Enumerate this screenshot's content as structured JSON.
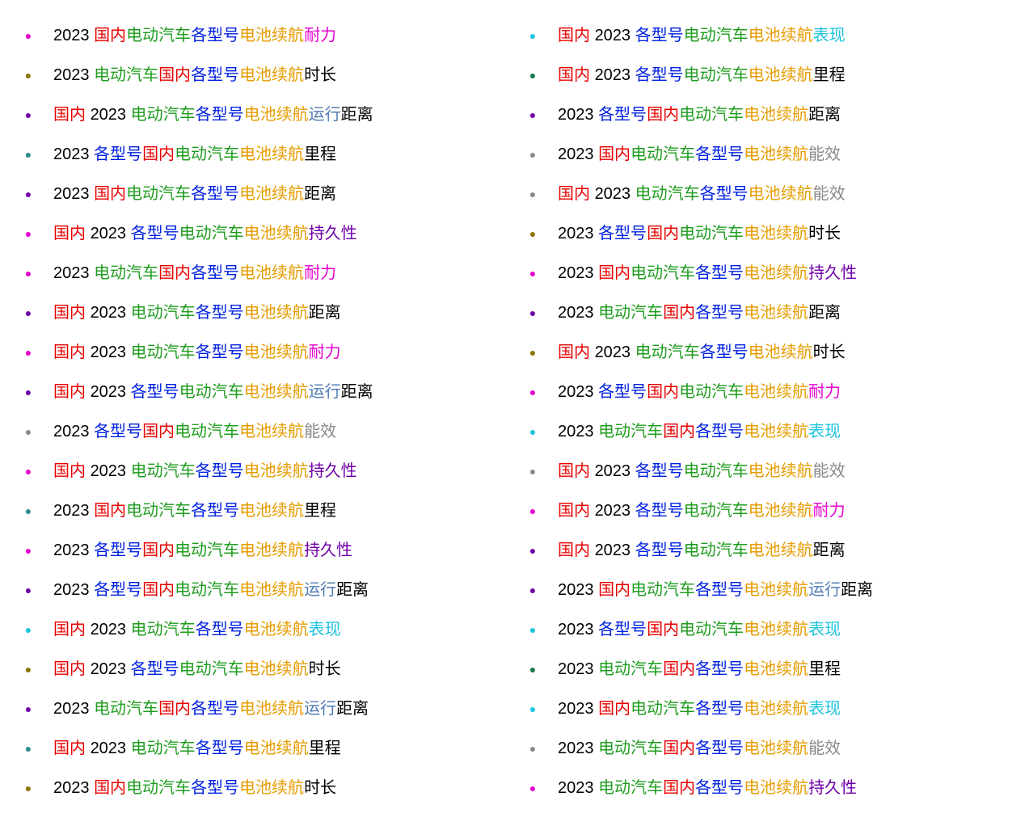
{
  "words": {
    "w2023": "2023 ",
    "guonei": "国内",
    "guonei_sp": "国内 ",
    "diandong": "电动汽车",
    "gexinghao": "各型号",
    "dianchi": "电池续航",
    "naili": "耐力",
    "shichang": "时长",
    "yunxing": "运行",
    "juli": "距离",
    "licheng": "里程",
    "chijiuxing": "持久性",
    "nengxiao": "能效",
    "biaoxian": "表现"
  },
  "bullet_colors": {
    "pink": "#e600cc",
    "darkkhaki": "#8b7300",
    "purple": "#6f00a8",
    "teal": "#2d8b8b",
    "gray": "#8a8a8a",
    "cyan": "#1cc3dd",
    "darkgreen": "#157a4a"
  },
  "left": [
    {
      "b": "pink",
      "seg": [
        [
          "black",
          "w2023"
        ],
        [
          "red",
          "guonei"
        ],
        [
          "green",
          "diandong"
        ],
        [
          "blue",
          "gexinghao"
        ],
        [
          "orange",
          "dianchi"
        ],
        [
          "pink",
          "naili"
        ]
      ]
    },
    {
      "b": "darkkhaki",
      "seg": [
        [
          "black",
          "w2023"
        ],
        [
          "green",
          "diandong"
        ],
        [
          "red",
          "guonei"
        ],
        [
          "blue",
          "gexinghao"
        ],
        [
          "orange",
          "dianchi"
        ],
        [
          "black",
          "shichang"
        ]
      ]
    },
    {
      "b": "purple",
      "seg": [
        [
          "red",
          "guonei_sp"
        ],
        [
          "black",
          "w2023"
        ],
        [
          "green",
          "diandong"
        ],
        [
          "blue",
          "gexinghao"
        ],
        [
          "orange",
          "dianchi"
        ],
        [
          "steel",
          "yunxing"
        ],
        [
          "black",
          "juli"
        ]
      ]
    },
    {
      "b": "teal",
      "seg": [
        [
          "black",
          "w2023"
        ],
        [
          "blue",
          "gexinghao"
        ],
        [
          "red",
          "guonei"
        ],
        [
          "green",
          "diandong"
        ],
        [
          "orange",
          "dianchi"
        ],
        [
          "black",
          "licheng"
        ]
      ]
    },
    {
      "b": "purple",
      "seg": [
        [
          "black",
          "w2023"
        ],
        [
          "red",
          "guonei"
        ],
        [
          "green",
          "diandong"
        ],
        [
          "blue",
          "gexinghao"
        ],
        [
          "orange",
          "dianchi"
        ],
        [
          "black",
          "juli"
        ]
      ]
    },
    {
      "b": "pink",
      "seg": [
        [
          "red",
          "guonei_sp"
        ],
        [
          "black",
          "w2023"
        ],
        [
          "blue",
          "gexinghao"
        ],
        [
          "green",
          "diandong"
        ],
        [
          "orange",
          "dianchi"
        ],
        [
          "purple",
          "chijiuxing"
        ]
      ]
    },
    {
      "b": "pink",
      "seg": [
        [
          "black",
          "w2023"
        ],
        [
          "green",
          "diandong"
        ],
        [
          "red",
          "guonei"
        ],
        [
          "blue",
          "gexinghao"
        ],
        [
          "orange",
          "dianchi"
        ],
        [
          "pink",
          "naili"
        ]
      ]
    },
    {
      "b": "purple",
      "seg": [
        [
          "red",
          "guonei_sp"
        ],
        [
          "black",
          "w2023"
        ],
        [
          "green",
          "diandong"
        ],
        [
          "blue",
          "gexinghao"
        ],
        [
          "orange",
          "dianchi"
        ],
        [
          "black",
          "juli"
        ]
      ]
    },
    {
      "b": "pink",
      "seg": [
        [
          "red",
          "guonei_sp"
        ],
        [
          "black",
          "w2023"
        ],
        [
          "green",
          "diandong"
        ],
        [
          "blue",
          "gexinghao"
        ],
        [
          "orange",
          "dianchi"
        ],
        [
          "pink",
          "naili"
        ]
      ]
    },
    {
      "b": "purple",
      "seg": [
        [
          "red",
          "guonei_sp"
        ],
        [
          "black",
          "w2023"
        ],
        [
          "blue",
          "gexinghao"
        ],
        [
          "green",
          "diandong"
        ],
        [
          "orange",
          "dianchi"
        ],
        [
          "steel",
          "yunxing"
        ],
        [
          "black",
          "juli"
        ]
      ]
    },
    {
      "b": "gray",
      "seg": [
        [
          "black",
          "w2023"
        ],
        [
          "blue",
          "gexinghao"
        ],
        [
          "red",
          "guonei"
        ],
        [
          "green",
          "diandong"
        ],
        [
          "orange",
          "dianchi"
        ],
        [
          "gray",
          "nengxiao"
        ]
      ]
    },
    {
      "b": "pink",
      "seg": [
        [
          "red",
          "guonei_sp"
        ],
        [
          "black",
          "w2023"
        ],
        [
          "green",
          "diandong"
        ],
        [
          "blue",
          "gexinghao"
        ],
        [
          "orange",
          "dianchi"
        ],
        [
          "purple",
          "chijiuxing"
        ]
      ]
    },
    {
      "b": "teal",
      "seg": [
        [
          "black",
          "w2023"
        ],
        [
          "red",
          "guonei"
        ],
        [
          "green",
          "diandong"
        ],
        [
          "blue",
          "gexinghao"
        ],
        [
          "orange",
          "dianchi"
        ],
        [
          "black",
          "licheng"
        ]
      ]
    },
    {
      "b": "pink",
      "seg": [
        [
          "black",
          "w2023"
        ],
        [
          "blue",
          "gexinghao"
        ],
        [
          "red",
          "guonei"
        ],
        [
          "green",
          "diandong"
        ],
        [
          "orange",
          "dianchi"
        ],
        [
          "purple",
          "chijiuxing"
        ]
      ]
    },
    {
      "b": "purple",
      "seg": [
        [
          "black",
          "w2023"
        ],
        [
          "blue",
          "gexinghao"
        ],
        [
          "red",
          "guonei"
        ],
        [
          "green",
          "diandong"
        ],
        [
          "orange",
          "dianchi"
        ],
        [
          "steel",
          "yunxing"
        ],
        [
          "black",
          "juli"
        ]
      ]
    },
    {
      "b": "cyan",
      "seg": [
        [
          "red",
          "guonei_sp"
        ],
        [
          "black",
          "w2023"
        ],
        [
          "green",
          "diandong"
        ],
        [
          "blue",
          "gexinghao"
        ],
        [
          "orange",
          "dianchi"
        ],
        [
          "cyan",
          "biaoxian"
        ]
      ]
    },
    {
      "b": "darkkhaki",
      "seg": [
        [
          "red",
          "guonei_sp"
        ],
        [
          "black",
          "w2023"
        ],
        [
          "blue",
          "gexinghao"
        ],
        [
          "green",
          "diandong"
        ],
        [
          "orange",
          "dianchi"
        ],
        [
          "black",
          "shichang"
        ]
      ]
    },
    {
      "b": "purple",
      "seg": [
        [
          "black",
          "w2023"
        ],
        [
          "green",
          "diandong"
        ],
        [
          "red",
          "guonei"
        ],
        [
          "blue",
          "gexinghao"
        ],
        [
          "orange",
          "dianchi"
        ],
        [
          "steel",
          "yunxing"
        ],
        [
          "black",
          "juli"
        ]
      ]
    },
    {
      "b": "teal",
      "seg": [
        [
          "red",
          "guonei_sp"
        ],
        [
          "black",
          "w2023"
        ],
        [
          "green",
          "diandong"
        ],
        [
          "blue",
          "gexinghao"
        ],
        [
          "orange",
          "dianchi"
        ],
        [
          "black",
          "licheng"
        ]
      ]
    },
    {
      "b": "darkkhaki",
      "seg": [
        [
          "black",
          "w2023"
        ],
        [
          "red",
          "guonei"
        ],
        [
          "green",
          "diandong"
        ],
        [
          "blue",
          "gexinghao"
        ],
        [
          "orange",
          "dianchi"
        ],
        [
          "black",
          "shichang"
        ]
      ]
    }
  ],
  "right": [
    {
      "b": "cyan",
      "seg": [
        [
          "red",
          "guonei_sp"
        ],
        [
          "black",
          "w2023"
        ],
        [
          "blue",
          "gexinghao"
        ],
        [
          "green",
          "diandong"
        ],
        [
          "orange",
          "dianchi"
        ],
        [
          "cyan",
          "biaoxian"
        ]
      ]
    },
    {
      "b": "darkgreen",
      "seg": [
        [
          "red",
          "guonei_sp"
        ],
        [
          "black",
          "w2023"
        ],
        [
          "blue",
          "gexinghao"
        ],
        [
          "green",
          "diandong"
        ],
        [
          "orange",
          "dianchi"
        ],
        [
          "black",
          "licheng"
        ]
      ]
    },
    {
      "b": "purple",
      "seg": [
        [
          "black",
          "w2023"
        ],
        [
          "blue",
          "gexinghao"
        ],
        [
          "red",
          "guonei"
        ],
        [
          "green",
          "diandong"
        ],
        [
          "orange",
          "dianchi"
        ],
        [
          "black",
          "juli"
        ]
      ]
    },
    {
      "b": "gray",
      "seg": [
        [
          "black",
          "w2023"
        ],
        [
          "red",
          "guonei"
        ],
        [
          "green",
          "diandong"
        ],
        [
          "blue",
          "gexinghao"
        ],
        [
          "orange",
          "dianchi"
        ],
        [
          "gray",
          "nengxiao"
        ]
      ]
    },
    {
      "b": "gray",
      "seg": [
        [
          "red",
          "guonei_sp"
        ],
        [
          "black",
          "w2023"
        ],
        [
          "green",
          "diandong"
        ],
        [
          "blue",
          "gexinghao"
        ],
        [
          "orange",
          "dianchi"
        ],
        [
          "gray",
          "nengxiao"
        ]
      ]
    },
    {
      "b": "darkkhaki",
      "seg": [
        [
          "black",
          "w2023"
        ],
        [
          "blue",
          "gexinghao"
        ],
        [
          "red",
          "guonei"
        ],
        [
          "green",
          "diandong"
        ],
        [
          "orange",
          "dianchi"
        ],
        [
          "black",
          "shichang"
        ]
      ]
    },
    {
      "b": "pink",
      "seg": [
        [
          "black",
          "w2023"
        ],
        [
          "red",
          "guonei"
        ],
        [
          "green",
          "diandong"
        ],
        [
          "blue",
          "gexinghao"
        ],
        [
          "orange",
          "dianchi"
        ],
        [
          "purple",
          "chijiuxing"
        ]
      ]
    },
    {
      "b": "purple",
      "seg": [
        [
          "black",
          "w2023"
        ],
        [
          "green",
          "diandong"
        ],
        [
          "red",
          "guonei"
        ],
        [
          "blue",
          "gexinghao"
        ],
        [
          "orange",
          "dianchi"
        ],
        [
          "black",
          "juli"
        ]
      ]
    },
    {
      "b": "darkkhaki",
      "seg": [
        [
          "red",
          "guonei_sp"
        ],
        [
          "black",
          "w2023"
        ],
        [
          "green",
          "diandong"
        ],
        [
          "blue",
          "gexinghao"
        ],
        [
          "orange",
          "dianchi"
        ],
        [
          "black",
          "shichang"
        ]
      ]
    },
    {
      "b": "pink",
      "seg": [
        [
          "black",
          "w2023"
        ],
        [
          "blue",
          "gexinghao"
        ],
        [
          "red",
          "guonei"
        ],
        [
          "green",
          "diandong"
        ],
        [
          "orange",
          "dianchi"
        ],
        [
          "pink",
          "naili"
        ]
      ]
    },
    {
      "b": "cyan",
      "seg": [
        [
          "black",
          "w2023"
        ],
        [
          "green",
          "diandong"
        ],
        [
          "red",
          "guonei"
        ],
        [
          "blue",
          "gexinghao"
        ],
        [
          "orange",
          "dianchi"
        ],
        [
          "cyan",
          "biaoxian"
        ]
      ]
    },
    {
      "b": "gray",
      "seg": [
        [
          "red",
          "guonei_sp"
        ],
        [
          "black",
          "w2023"
        ],
        [
          "blue",
          "gexinghao"
        ],
        [
          "green",
          "diandong"
        ],
        [
          "orange",
          "dianchi"
        ],
        [
          "gray",
          "nengxiao"
        ]
      ]
    },
    {
      "b": "pink",
      "seg": [
        [
          "red",
          "guonei_sp"
        ],
        [
          "black",
          "w2023"
        ],
        [
          "blue",
          "gexinghao"
        ],
        [
          "green",
          "diandong"
        ],
        [
          "orange",
          "dianchi"
        ],
        [
          "pink",
          "naili"
        ]
      ]
    },
    {
      "b": "purple",
      "seg": [
        [
          "red",
          "guonei_sp"
        ],
        [
          "black",
          "w2023"
        ],
        [
          "blue",
          "gexinghao"
        ],
        [
          "green",
          "diandong"
        ],
        [
          "orange",
          "dianchi"
        ],
        [
          "black",
          "juli"
        ]
      ]
    },
    {
      "b": "purple",
      "seg": [
        [
          "black",
          "w2023"
        ],
        [
          "red",
          "guonei"
        ],
        [
          "green",
          "diandong"
        ],
        [
          "blue",
          "gexinghao"
        ],
        [
          "orange",
          "dianchi"
        ],
        [
          "steel",
          "yunxing"
        ],
        [
          "black",
          "juli"
        ]
      ]
    },
    {
      "b": "cyan",
      "seg": [
        [
          "black",
          "w2023"
        ],
        [
          "blue",
          "gexinghao"
        ],
        [
          "red",
          "guonei"
        ],
        [
          "green",
          "diandong"
        ],
        [
          "orange",
          "dianchi"
        ],
        [
          "cyan",
          "biaoxian"
        ]
      ]
    },
    {
      "b": "darkgreen",
      "seg": [
        [
          "black",
          "w2023"
        ],
        [
          "green",
          "diandong"
        ],
        [
          "red",
          "guonei"
        ],
        [
          "blue",
          "gexinghao"
        ],
        [
          "orange",
          "dianchi"
        ],
        [
          "black",
          "licheng"
        ]
      ]
    },
    {
      "b": "cyan",
      "seg": [
        [
          "black",
          "w2023"
        ],
        [
          "red",
          "guonei"
        ],
        [
          "green",
          "diandong"
        ],
        [
          "blue",
          "gexinghao"
        ],
        [
          "orange",
          "dianchi"
        ],
        [
          "cyan",
          "biaoxian"
        ]
      ]
    },
    {
      "b": "gray",
      "seg": [
        [
          "black",
          "w2023"
        ],
        [
          "green",
          "diandong"
        ],
        [
          "red",
          "guonei"
        ],
        [
          "blue",
          "gexinghao"
        ],
        [
          "orange",
          "dianchi"
        ],
        [
          "gray",
          "nengxiao"
        ]
      ]
    },
    {
      "b": "pink",
      "seg": [
        [
          "black",
          "w2023"
        ],
        [
          "green",
          "diandong"
        ],
        [
          "red",
          "guonei"
        ],
        [
          "blue",
          "gexinghao"
        ],
        [
          "orange",
          "dianchi"
        ],
        [
          "purple",
          "chijiuxing"
        ]
      ]
    }
  ]
}
